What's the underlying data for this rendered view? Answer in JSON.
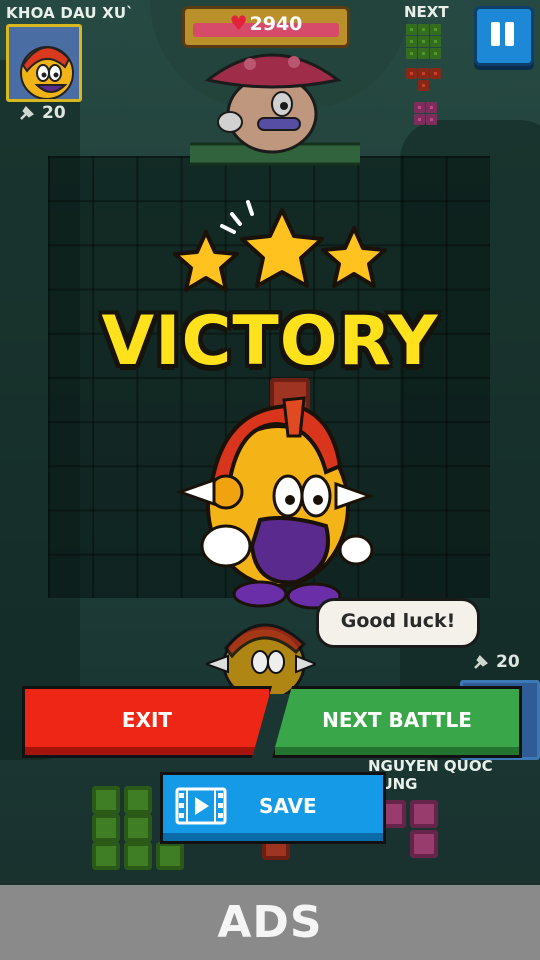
{
  "player1": {
    "name": "KHOA DAU XU`",
    "pins": "20"
  },
  "boss": {
    "hp": "2940"
  },
  "next": {
    "label": "NEXT"
  },
  "result": {
    "title": "VICTORY",
    "stars": 3,
    "speech": "Good luck!"
  },
  "player2": {
    "name": "NGUYEN QUOC DUNG",
    "pins": "20"
  },
  "buttons": {
    "exit": "EXIT",
    "next_battle": "NEXT BATTLE",
    "save": "SAVE"
  },
  "ads": {
    "label": "ADS"
  },
  "colors": {
    "victory": "#ffe11c",
    "exit": "#ee2616",
    "next_battle": "#3aa64a",
    "save": "#149ae6",
    "hp": "#d64a6a"
  },
  "icons": {
    "pause": "pause-icon",
    "heart": "heart-icon",
    "pin": "pin-icon",
    "video": "film-strip-icon",
    "star": "star-icon"
  }
}
